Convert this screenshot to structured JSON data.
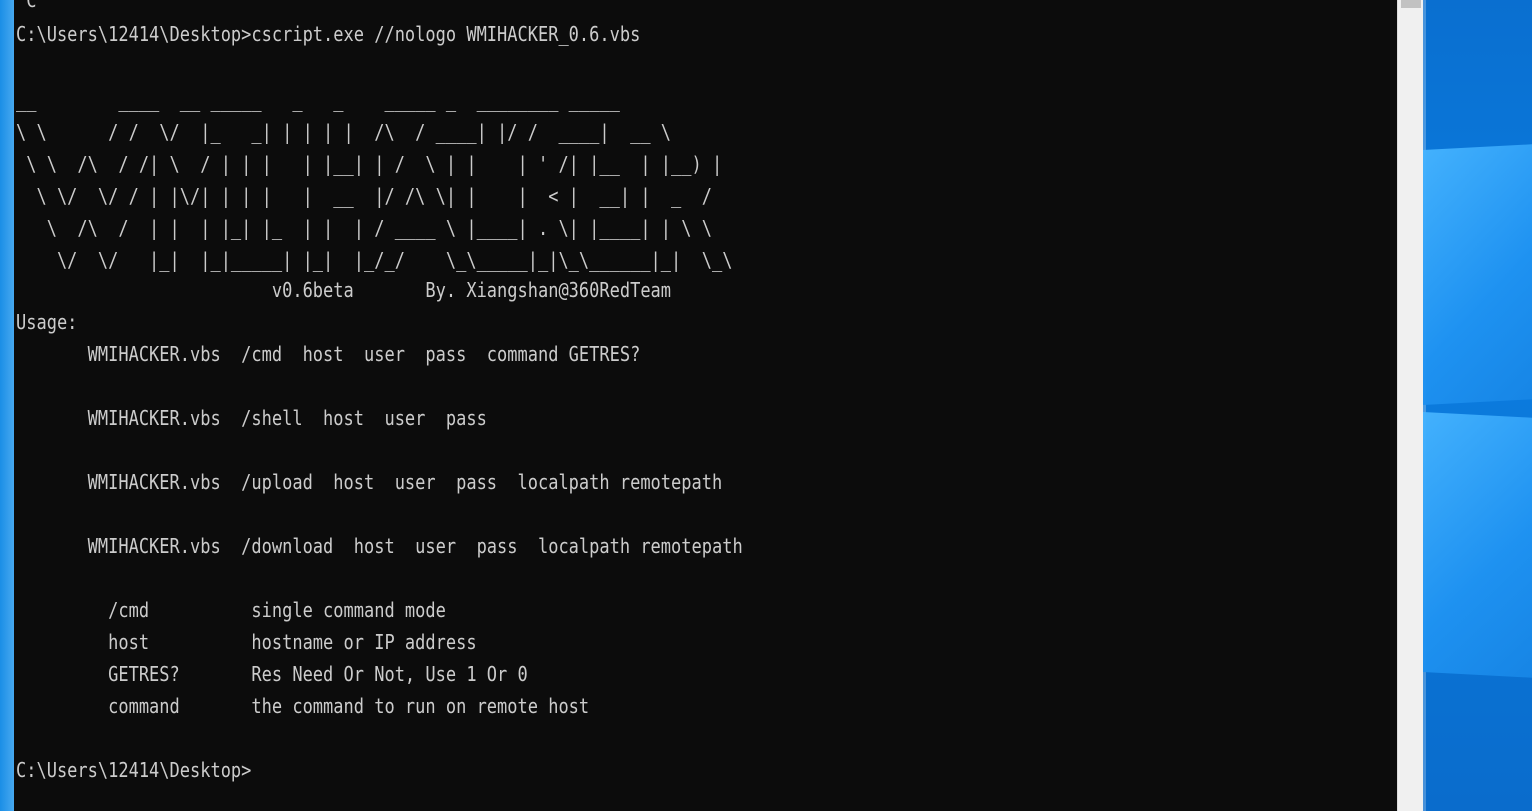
{
  "console": {
    "partial_top_line": "^C",
    "prompt_line_1": "C:\\Users\\12414\\Desktop>cscript.exe //nologo WMIHACKER_0.6.vbs",
    "banner_ascii": "__        ____  __ _____   _   _    _____ _  ________ _____\n\\ \\      / /  \\/  |_   _| | | | |  /\\  / ____| |/ /  ____|  __ \\\n \\ \\  /\\  / /| \\  / | | |   | |__| | /  \\ | |    | ' /| |__  | |__) |\n  \\ \\/  \\/ / | |\\/| | | |   |  __  |/ /\\ \\| |    |  < |  __| |  _  /\n   \\  /\\  /  | |  | |_| |_  | |  | / ____ \\ |____| . \\| |____| | \\ \\\n    \\/  \\/   |_|  |_|_____| |_|  |_/_/    \\_\\_____|_|\\_\\______|_|  \\_\\",
    "version_line": "                         v0.6beta       By. Xiangshan@360RedTeam",
    "usage_heading": "Usage:",
    "usage_lines": [
      "       WMIHACKER.vbs  /cmd  host  user  pass  command GETRES?",
      "       WMIHACKER.vbs  /shell  host  user  pass",
      "       WMIHACKER.vbs  /upload  host  user  pass  localpath remotepath",
      "       WMIHACKER.vbs  /download  host  user  pass  localpath remotepath"
    ],
    "param_lines": [
      "         /cmd          single command mode",
      "         host          hostname or IP address",
      "         GETRES?       Res Need Or Not, Use 1 Or 0",
      "         command       the command to run on remote host"
    ],
    "prompt_line_2": "C:\\Users\\12414\\Desktop>"
  },
  "colors": {
    "console_background": "#0c0c0c",
    "console_text": "#cccccc",
    "desktop_accent": "#0a78d7"
  }
}
